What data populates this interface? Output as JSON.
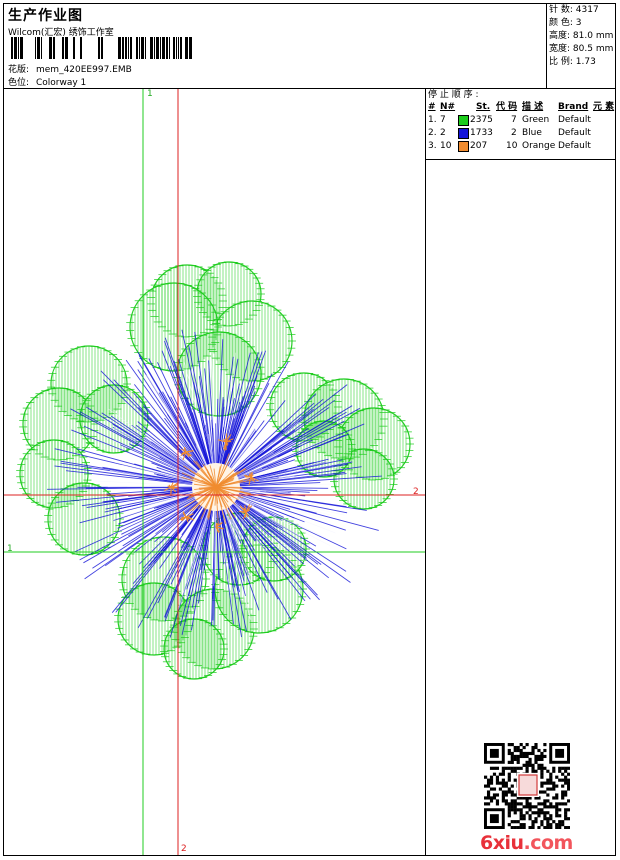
{
  "header": {
    "title": "生产作业图",
    "company": "Wilcom(汇宏) 绣饰工作室",
    "design_label": "花版:",
    "design_value": "mem_420EE997.EMB",
    "colorway_label": "色位:",
    "colorway_value": "Colorway 1"
  },
  "stats": [
    {
      "label": "针 数:",
      "value": "4317"
    },
    {
      "label": "颜 色:",
      "value": "3"
    },
    {
      "label": "高度:",
      "value": "81.0 mm"
    },
    {
      "label": "宽度:",
      "value": "80.5 mm"
    },
    {
      "label": "比 例:",
      "value": "1.73"
    }
  ],
  "guides": {
    "green_v": "1",
    "green_h": "1",
    "red_v": "2",
    "red_h": "2"
  },
  "color_table": {
    "title": "停 止 顺 序 :",
    "headers": [
      "#",
      "N#",
      "St.",
      "代 码",
      "描 述",
      "Brand",
      "元 素"
    ],
    "rows": [
      {
        "stop": "1.",
        "needle": "7",
        "color": "#1ccc1c",
        "stitches": "2375",
        "code": "7",
        "desc": "Green",
        "brand": "Default"
      },
      {
        "stop": "2.",
        "needle": "2",
        "color": "#1414d8",
        "stitches": "1733",
        "code": "2",
        "desc": "Blue",
        "brand": "Default"
      },
      {
        "stop": "3.",
        "needle": "10",
        "color": "#f08c30",
        "stitches": "207",
        "code": "10",
        "desc": "Orange",
        "brand": "Default"
      }
    ]
  },
  "watermark": {
    "brand_a": "6xiu",
    "brand_b": ".com"
  }
}
